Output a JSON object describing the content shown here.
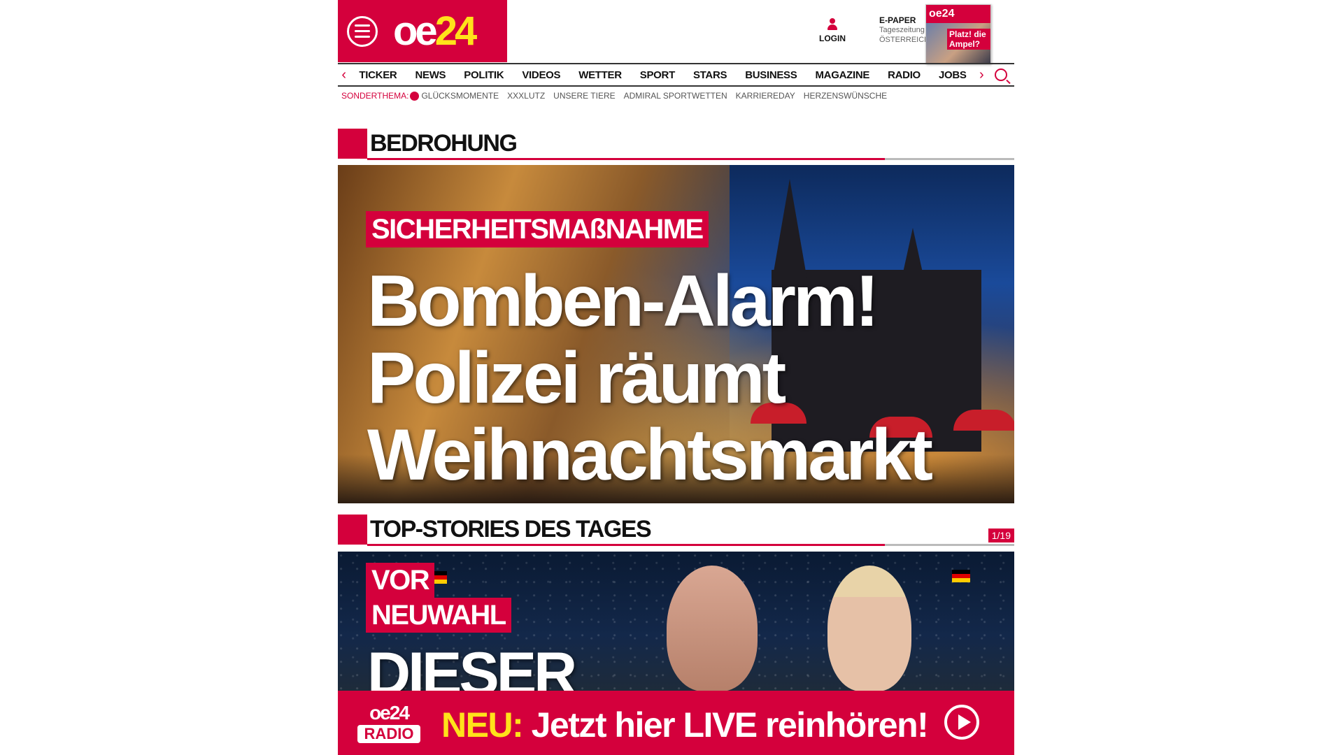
{
  "brand": {
    "logo_main": "oe",
    "logo_accent": "24",
    "accent": "#d4003c"
  },
  "header": {
    "login_label": "LOGIN",
    "epaper_title": "E-PAPER",
    "epaper_sub1": "Tageszeitung",
    "epaper_sub2": "ÖSTERREICH",
    "cover_logo": "oe24",
    "cover_headline": "Platz! die Ampel?"
  },
  "nav": {
    "prev": "‹",
    "next": "›",
    "items": [
      "TICKER",
      "NEWS",
      "POLITIK",
      "VIDEOS",
      "WETTER",
      "SPORT",
      "STARS",
      "BUSINESS",
      "MAGAZINE",
      "RADIO",
      "JOBS"
    ]
  },
  "subnav": {
    "lead": "SONDERTHEMA:",
    "items": [
      "GLÜCKSMOMENTE",
      "XXXLUTZ",
      "UNSERE TIERE",
      "ADMIRAL SPORTWETTEN",
      "KARRIEREDAY",
      "HERZENSWÜNSCHE"
    ]
  },
  "section1": {
    "title": "BEDROHUNG"
  },
  "hero": {
    "kicker": "SICHERHEITSMAßNAHME",
    "line1": "Bomben-Alarm!",
    "line2": "Polizei räumt",
    "line3": "Weihnachtsmarkt"
  },
  "section2": {
    "title": "TOP-STORIES DES TAGES",
    "counter": "1/19"
  },
  "story2": {
    "kicker1": "VOR",
    "kicker2": "NEUWAHL",
    "headline": "DIESER"
  },
  "radio": {
    "logo_top": "oe24",
    "logo_bottom": "RADIO",
    "prefix": "NEU:",
    "text": " Jetzt hier LIVE reinhören!"
  }
}
